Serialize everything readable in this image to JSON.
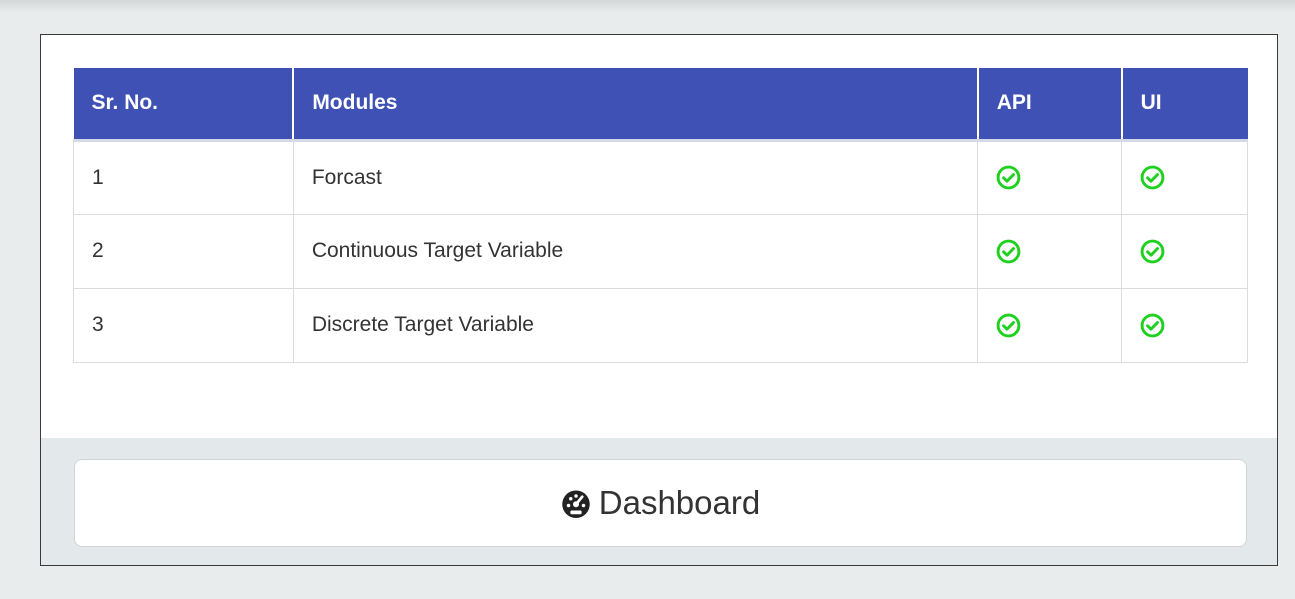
{
  "table": {
    "headers": {
      "sr": "Sr. No.",
      "modules": "Modules",
      "api": "API",
      "ui": "UI"
    },
    "rows": [
      {
        "sr": "1",
        "module": "Forcast",
        "api": "check-circle-icon",
        "ui": "check-circle-icon"
      },
      {
        "sr": "2",
        "module": "Continuous Target Variable",
        "api": "check-circle-icon",
        "ui": "check-circle-icon"
      },
      {
        "sr": "3",
        "module": "Discrete Target Variable",
        "api": "check-circle-icon",
        "ui": "check-circle-icon"
      }
    ]
  },
  "footer": {
    "dashboard_label": "Dashboard",
    "dashboard_icon": "dashboard-gauge-icon"
  },
  "colors": {
    "header_bg": "#3f51b5",
    "check_green": "#1fd11f",
    "footer_bg": "#e3e8ea"
  }
}
